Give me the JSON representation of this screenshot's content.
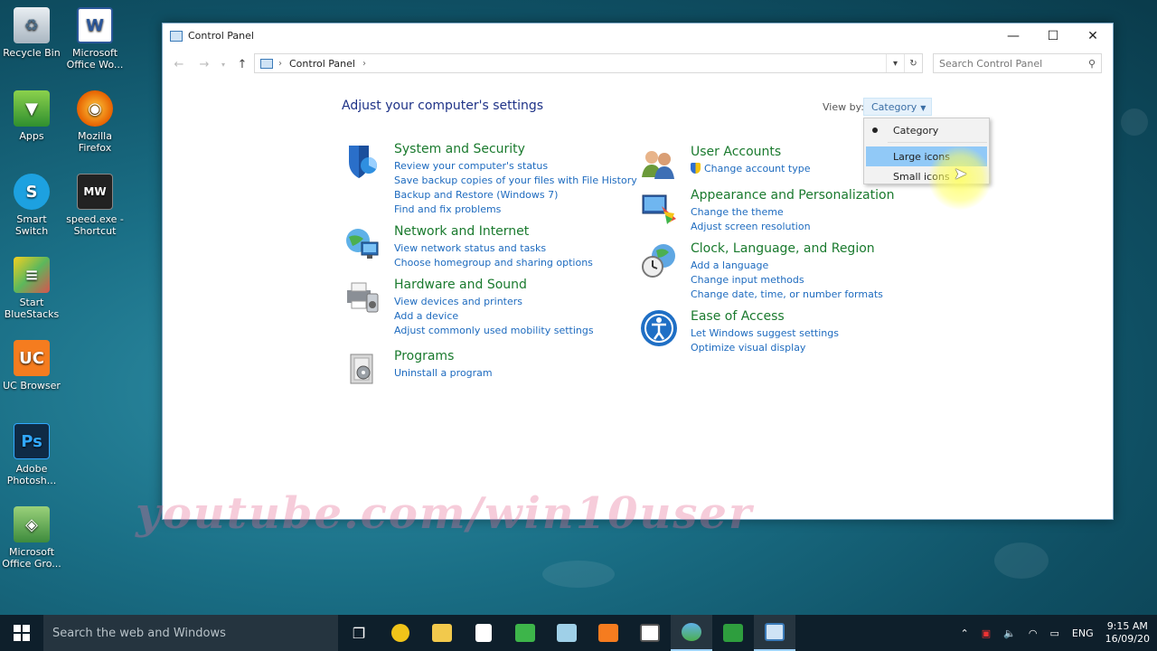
{
  "desktop": {
    "icons": [
      {
        "label": "Recycle Bin",
        "icon": "recycle-bin-icon"
      },
      {
        "label": "Microsoft Office Wo...",
        "icon": "word-icon"
      },
      {
        "label": "Apps",
        "icon": "apps-icon"
      },
      {
        "label": "Mozilla Firefox",
        "icon": "firefox-icon"
      },
      {
        "label": "Smart Switch",
        "icon": "smart-switch-icon"
      },
      {
        "label": "speed.exe - Shortcut",
        "icon": "speed-exe-icon"
      },
      {
        "label": "Start BlueStacks",
        "icon": "bluestacks-icon"
      },
      {
        "label": "UC Browser",
        "icon": "uc-browser-icon"
      },
      {
        "label": "Adobe Photosh...",
        "icon": "photoshop-icon"
      },
      {
        "label": "Microsoft Office Gro...",
        "icon": "office-groove-icon"
      }
    ],
    "watermark": "youtube.com/win10user"
  },
  "window": {
    "title": "Control Panel",
    "address": {
      "crumb": "Control Panel"
    },
    "search_placeholder": "Search Control Panel",
    "heading": "Adjust your computer's settings",
    "view_by": {
      "label": "View by:",
      "selected": "Category",
      "options": [
        "Category",
        "Large icons",
        "Small icons"
      ]
    },
    "categories": [
      {
        "title": "System and Security",
        "links": [
          "Review your computer's status",
          "Save backup copies of your files with File History",
          "Backup and Restore (Windows 7)",
          "Find and fix problems"
        ]
      },
      {
        "title": "Network and Internet",
        "links": [
          "View network status and tasks",
          "Choose homegroup and sharing options"
        ]
      },
      {
        "title": "Hardware and Sound",
        "links": [
          "View devices and printers",
          "Add a device",
          "Adjust commonly used mobility settings"
        ]
      },
      {
        "title": "Programs",
        "links": [
          "Uninstall a program"
        ]
      },
      {
        "title": "User Accounts",
        "links": [
          "Change account type"
        ]
      },
      {
        "title": "Appearance and Personalization",
        "links": [
          "Change the theme",
          "Adjust screen resolution"
        ]
      },
      {
        "title": "Clock, Language, and Region",
        "links": [
          "Add a language",
          "Change input methods",
          "Change date, time, or number formats"
        ]
      },
      {
        "title": "Ease of Access",
        "links": [
          "Let Windows suggest settings",
          "Optimize visual display"
        ]
      }
    ]
  },
  "taskbar": {
    "search_placeholder": "Search the web and Windows",
    "language": "ENG",
    "time": "9:15 AM",
    "date": "16/09/20"
  },
  "colors": {
    "category_title": "#1a7a2e",
    "link": "#1e6bbf",
    "heading": "#1e3287",
    "taskbar": "#0e1f2b"
  }
}
